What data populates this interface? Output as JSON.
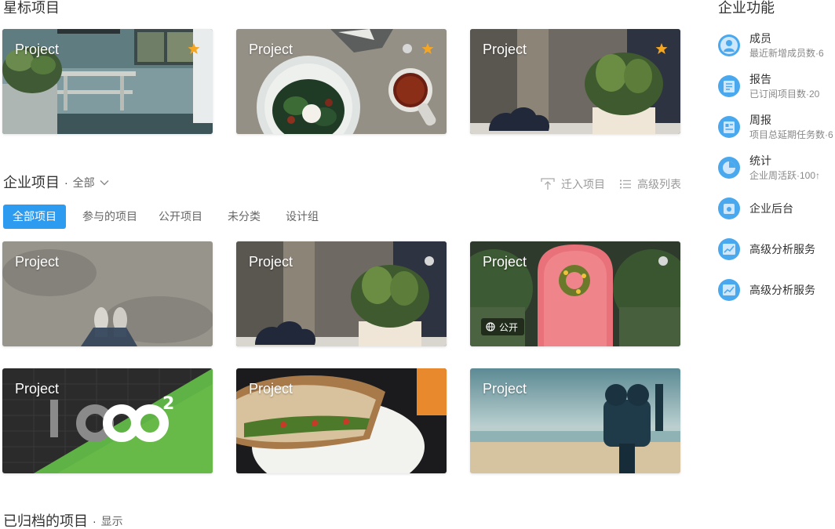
{
  "starred": {
    "title": "星标项目",
    "cards": [
      {
        "label": "Project"
      },
      {
        "label": "Project"
      },
      {
        "label": "Project"
      }
    ]
  },
  "enterprise": {
    "title": "企业项目",
    "sep": "·",
    "filter": "全部",
    "tools": {
      "move_in": "迁入项目",
      "advanced_list": "高级列表"
    },
    "tabs": [
      "全部项目",
      "参与的项目",
      "公开项目",
      "未分类",
      "设计组"
    ],
    "cards": [
      {
        "label": "Project"
      },
      {
        "label": "Project"
      },
      {
        "label": "Project",
        "badge": "公开"
      },
      {
        "label": "Project"
      },
      {
        "label": "Project"
      },
      {
        "label": "Project"
      }
    ]
  },
  "archived": {
    "title": "已归档的项目",
    "sep": "·",
    "toggle": "显示"
  },
  "features": {
    "title": "企业功能",
    "items": [
      {
        "name": "成员",
        "sub": "最近新增成员数·6",
        "icon": "member-icon"
      },
      {
        "name": "报告",
        "sub": "已订阅项目数·20",
        "icon": "report-icon"
      },
      {
        "name": "周报",
        "sub": "项目总延期任务数·6",
        "icon": "weekly-report-icon"
      },
      {
        "name": "统计",
        "sub": "企业周活跃·100↑",
        "icon": "statistics-icon"
      },
      {
        "name": "企业后台",
        "sub": "",
        "icon": "admin-icon"
      },
      {
        "name": "高级分析服务",
        "sub": "",
        "icon": "analytics-icon"
      },
      {
        "name": "高级分析服务",
        "sub": "",
        "icon": "analytics-icon"
      }
    ]
  },
  "colors": {
    "accent": "#2d9bf0",
    "star": "#f5a623",
    "icon_blue": "#4aa9ee"
  }
}
